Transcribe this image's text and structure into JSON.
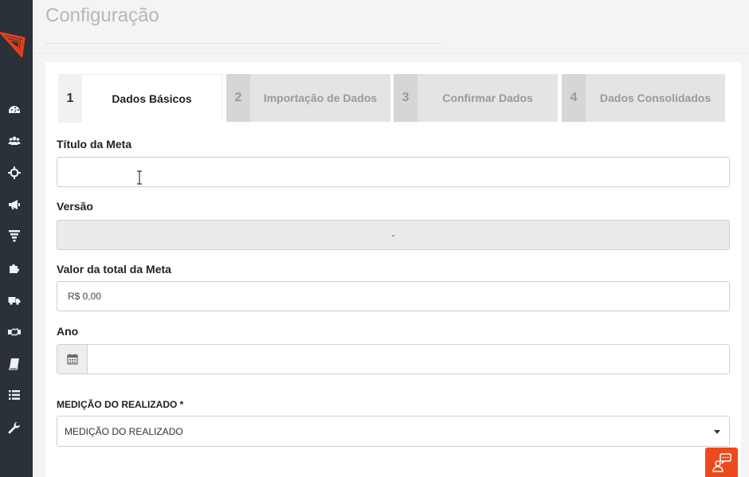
{
  "header": {
    "title": "Configuração"
  },
  "sidebar": {
    "icons": [
      "dashboard-icon",
      "users-icon",
      "crosshair-icon",
      "megaphone-icon",
      "funnel-icon",
      "puzzle-icon",
      "truck-icon",
      "handshake-icon",
      "book-icon",
      "list-icon",
      "wrench-icon"
    ]
  },
  "wizard": {
    "steps": [
      {
        "number": "1",
        "label": "Dados Básicos",
        "active": true
      },
      {
        "number": "2",
        "label": "Importação de Dados",
        "active": false
      },
      {
        "number": "3",
        "label": "Confirmar Dados",
        "active": false
      },
      {
        "number": "4",
        "label": "Dados Consolidados",
        "active": false
      }
    ]
  },
  "form": {
    "titulo": {
      "label": "Título da Meta",
      "value": ""
    },
    "versao": {
      "label": "Versão",
      "value": "-"
    },
    "valor": {
      "label": "Valor da total da Meta",
      "value": "R$ 0,00"
    },
    "ano": {
      "label": "Ano",
      "value": ""
    },
    "medicao": {
      "label": "MEDIÇÃO DO REALIZADO *",
      "selected": "MEDIÇÃO DO REALIZADO"
    }
  },
  "colors": {
    "sidebar": "#2a3138",
    "brand": "#ec4a1e",
    "page_bg": "#f4f4f4"
  }
}
